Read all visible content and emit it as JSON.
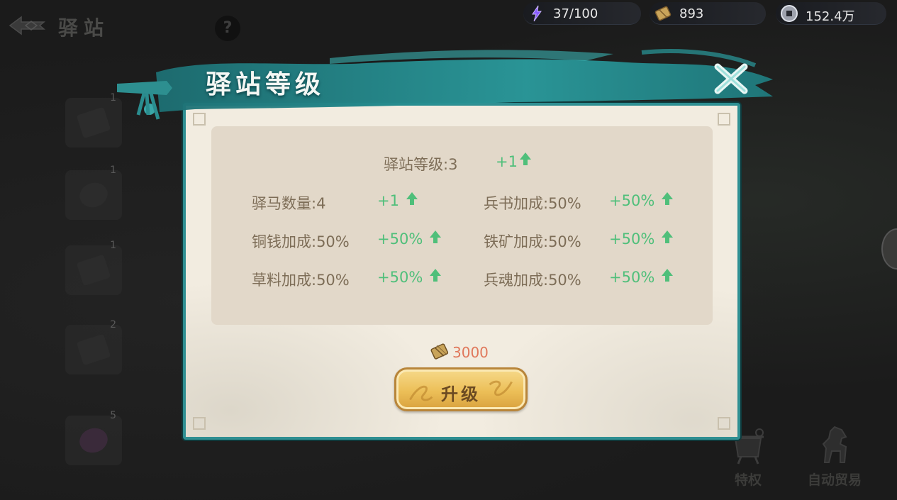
{
  "scene": {
    "title": "驿站",
    "help_symbol": "?",
    "side_slots": [
      {
        "count": "1"
      },
      {
        "count": "1"
      },
      {
        "count": "1"
      },
      {
        "count": "2"
      },
      {
        "count": "5"
      }
    ],
    "bottom_buttons": [
      {
        "label": "特权",
        "icon": "cauldron-icon"
      },
      {
        "label": "自动贸易",
        "icon": "horse-icon"
      }
    ]
  },
  "resources": [
    {
      "icon": "energy-crystal-icon",
      "value": "37/100",
      "color": "#8a5cff"
    },
    {
      "icon": "scroll-icon",
      "value": "893",
      "color": "#c9a45a"
    },
    {
      "icon": "coin-icon",
      "value": "152.4万",
      "color": "#bfc3cf"
    }
  ],
  "dialog": {
    "title": "驿站等级",
    "level": {
      "label": "驿站等级:3",
      "bonus": "+1"
    },
    "stats": [
      {
        "label": "驿马数量:4",
        "bonus": "+1"
      },
      {
        "label": "兵书加成:50%",
        "bonus": "+50%"
      },
      {
        "label": "铜钱加成:50%",
        "bonus": "+50%"
      },
      {
        "label": "铁矿加成:50%",
        "bonus": "+50%"
      },
      {
        "label": "草料加成:50%",
        "bonus": "+50%"
      },
      {
        "label": "兵魂加成:50%",
        "bonus": "+50%"
      }
    ],
    "cost": {
      "icon": "scroll-icon",
      "value": "3000"
    },
    "upgrade_label": "升级"
  },
  "colors": {
    "accent_teal": "#2f8f92",
    "bonus_green": "#4fbf7a",
    "cost_orange": "#e0775a",
    "button_gold": "#ecbf58"
  }
}
